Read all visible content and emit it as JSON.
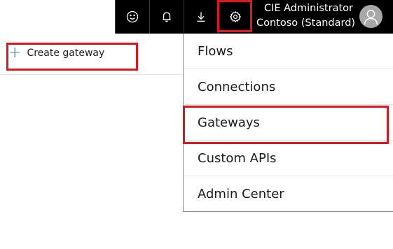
{
  "header": {
    "icons": {
      "smiley": "smiley-icon",
      "notifications": "bell-icon",
      "download": "download-icon",
      "settings": "gear-icon"
    },
    "account": {
      "name": "CIE Administrator",
      "organization": "Contoso (Standard)"
    }
  },
  "toolbar": {
    "create_gateway_label": "Create gateway"
  },
  "settings_menu": {
    "items": [
      {
        "label": "Flows"
      },
      {
        "label": "Connections"
      },
      {
        "label": "Gateways"
      },
      {
        "label": "Custom APIs"
      },
      {
        "label": "Admin Center"
      }
    ]
  },
  "colors": {
    "topbar_bg": "#000000",
    "highlight": "#e0161e",
    "accent": "#1b72c4"
  }
}
